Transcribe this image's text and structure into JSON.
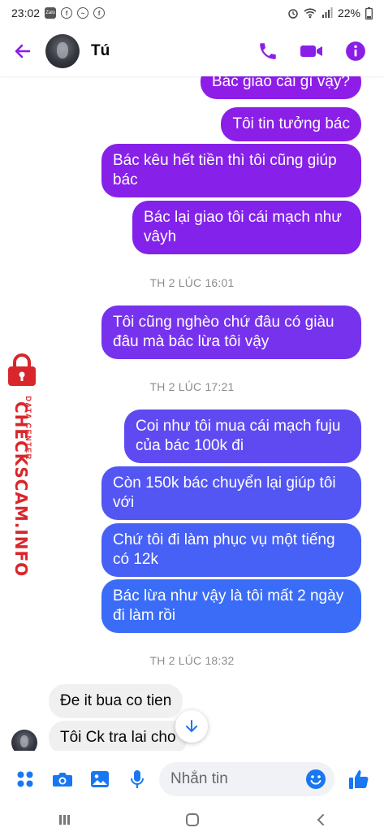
{
  "status_bar": {
    "time": "23:02",
    "battery": "22%",
    "zalo_label": "Zalo"
  },
  "header": {
    "contact_name": "Tú"
  },
  "colors": {
    "accent": "#8b1ee6",
    "bubble_top": "#8f1de8",
    "bubble_bottom": "#3a6cf7",
    "watermark": "#d9262c"
  },
  "messages": [
    {
      "type": "out",
      "text": "Bác giao cái gì vậy?"
    },
    {
      "type": "out",
      "text": "Tôi tin tưởng bác"
    },
    {
      "type": "out",
      "text": "Bác kêu hết tiền thì tôi cũng giúp bác"
    },
    {
      "type": "out",
      "text": "Bác lại giao tôi cái mạch như vâyh"
    },
    {
      "type": "timestamp",
      "text": "TH 2 LÚC 16:01"
    },
    {
      "type": "out",
      "text": "Tôi cũng nghèo chứ đâu có giàu đâu mà bác lừa tôi vậy"
    },
    {
      "type": "timestamp",
      "text": "TH 2 LÚC 17:21"
    },
    {
      "type": "out",
      "text": "Coi như tôi mua cái mạch fuju của bác 100k đi"
    },
    {
      "type": "out",
      "text": "Còn 150k bác chuyển lại giúp tôi với"
    },
    {
      "type": "out",
      "text": "Chứ tôi đi làm phục vụ một tiếng có 12k"
    },
    {
      "type": "out",
      "text": "Bác lừa như vậy là tôi mất 2 ngày đi làm rồi"
    },
    {
      "type": "timestamp",
      "text": "TH 2 LÚC 18:32"
    },
    {
      "type": "in",
      "text": "Đe it bua co tien"
    },
    {
      "type": "in",
      "text": "Tôi Ck tra lai cho"
    }
  ],
  "composer": {
    "placeholder": "Nhắn tin"
  },
  "watermark": {
    "main": "CHECKSCAM.INFO",
    "sub": "DATA CENTER"
  },
  "icons": [
    "back-arrow-icon",
    "phone-icon",
    "video-camera-icon",
    "info-icon",
    "apps-grid-icon",
    "camera-icon",
    "image-icon",
    "microphone-icon",
    "emoji-icon",
    "thumbs-up-icon",
    "arrow-down-icon"
  ]
}
